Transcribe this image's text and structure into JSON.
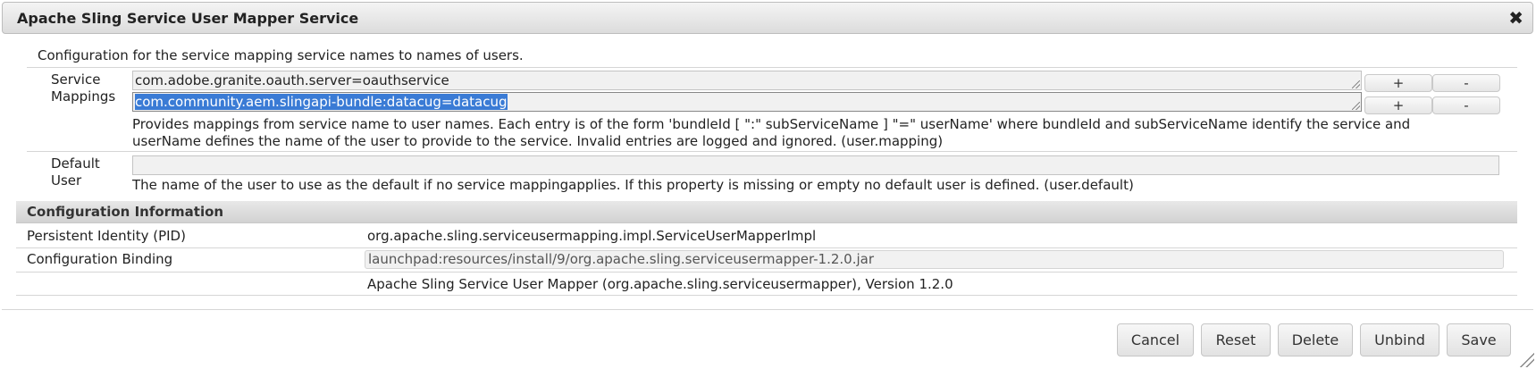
{
  "dialog": {
    "title": "Apache Sling Service User Mapper Service",
    "close_symbol": "✖",
    "description": "Configuration for the service mapping service names to names of users."
  },
  "service_mappings": {
    "label_line1": "Service",
    "label_line2": "Mappings",
    "entries": [
      {
        "value": "com.adobe.granite.oauth.server=oauthservice",
        "add_label": "+",
        "remove_label": "-"
      },
      {
        "value": "com.community.aem.slingapi-bundle:datacug=datacug",
        "add_label": "+",
        "remove_label": "-"
      }
    ],
    "help_line1": "Provides mappings from service name to user names. Each entry is of the form 'bundleId [ \":\" subServiceName ] \"=\" userName' where bundleId and subServiceName identify the service and",
    "help_line2": "userName defines the name of the user to provide to the service. Invalid entries are logged and ignored. (user.mapping)"
  },
  "default_user": {
    "label_line1": "Default",
    "label_line2": "User",
    "value": "",
    "help": "The name of the user to use as the default if no service mappingapplies. If this property is missing or empty no default user is defined. (user.default)"
  },
  "config_info": {
    "heading": "Configuration Information",
    "pid_label": "Persistent Identity (PID)",
    "pid_value": "org.apache.sling.serviceusermapping.impl.ServiceUserMapperImpl",
    "binding_label": "Configuration Binding",
    "binding_value": "launchpad:resources/install/9/org.apache.sling.serviceusermapper-1.2.0.jar",
    "bundle_value": "Apache Sling Service User Mapper (org.apache.sling.serviceusermapper), Version 1.2.0"
  },
  "footer": {
    "cancel": "Cancel",
    "reset": "Reset",
    "delete": "Delete",
    "unbind": "Unbind",
    "save": "Save"
  },
  "icons": {
    "close": "close-icon",
    "resize": "resize-grip-icon"
  }
}
